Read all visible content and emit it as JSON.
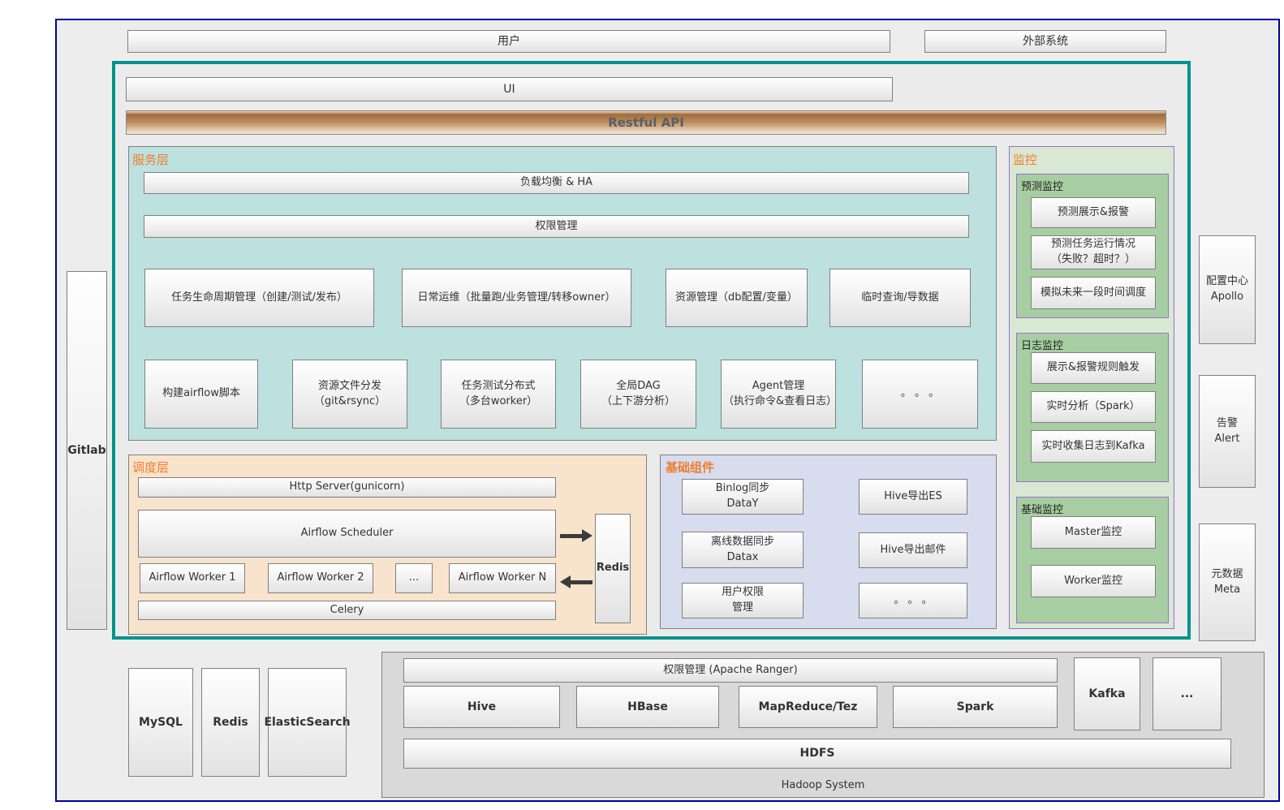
{
  "header": {
    "user_bar": "用户",
    "external_bar": "外部系统",
    "ui_bar": "UI",
    "api_bar": "Restful API"
  },
  "service_layer": {
    "label": "服务层",
    "bar1": "负载均衡 & HA",
    "bar2": "权限管理",
    "row1": [
      "任务生命周期管理（创建/测试/发布）",
      "日常运维（批量跑/业务管理/转移owner）",
      "资源管理（db配置/变量）",
      "临时查询/导数据"
    ],
    "row2": [
      "构建airflow脚本",
      "资源文件分发\n（git&rsync）",
      "任务测试分布式\n（多台worker）",
      "全局DAG\n（上下游分析）",
      "Agent管理\n（执行命令&查看日志）",
      "。 。 。"
    ]
  },
  "scheduler_layer": {
    "label": "调度层",
    "http_server": "Http Server(gunicorn)",
    "scheduler": "Airflow Scheduler",
    "workers": [
      "Airflow Worker 1",
      "Airflow Worker 2",
      "...",
      "Airflow Worker N"
    ],
    "celery": "Celery",
    "redis": "Redis"
  },
  "base_components": {
    "label": "基础组件",
    "items": [
      "Binlog同步\nDataY",
      "Hive导出ES",
      "离线数据同步\nDatax",
      "Hive导出邮件",
      "用户权限\n管理",
      "。 。 。"
    ]
  },
  "monitoring": {
    "label": "监控",
    "sections": [
      {
        "title": "预测监控",
        "items": [
          "预测展示&报警",
          "预测任务运行情况\n（失败？超时？）",
          "模拟未来一段时间调度"
        ]
      },
      {
        "title": "日志监控",
        "items": [
          "展示&报警规则触发",
          "实时分析（Spark）",
          "实时收集日志到Kafka"
        ]
      },
      {
        "title": "基础监控",
        "items": [
          "Master监控",
          "Worker监控"
        ]
      }
    ]
  },
  "left": {
    "gitlab": "Gitlab"
  },
  "right": {
    "apollo": "配置中心\nApollo",
    "alert": "告警\nAlert",
    "meta": "元数据\nMeta"
  },
  "storage": {
    "mysql": "MySQL",
    "redis": "Redis",
    "es": "ElasticSearch"
  },
  "hadoop": {
    "ranger": "权限管理 (Apache Ranger)",
    "engines": [
      "Hive",
      "HBase",
      "MapReduce/Tez",
      "Spark"
    ],
    "kafka": "Kafka",
    "more": "...",
    "hdfs": "HDFS",
    "caption": "Hadoop System"
  },
  "colors": {
    "outer_border": "#00009b",
    "main_border": "#00938c",
    "section_label": "#f07d2d",
    "service_bg": "#bce1df",
    "scheduler_bg": "#f8e3cc",
    "components_bg": "#d7dcee",
    "monitor_bg": "#d9e8d2",
    "monitor_inner_bg": "#a7cea2",
    "monitor_border": "#9a6fd0",
    "api_bar_brown": "#bd8b5a",
    "hadoop_bg": "#d9d9d9"
  }
}
